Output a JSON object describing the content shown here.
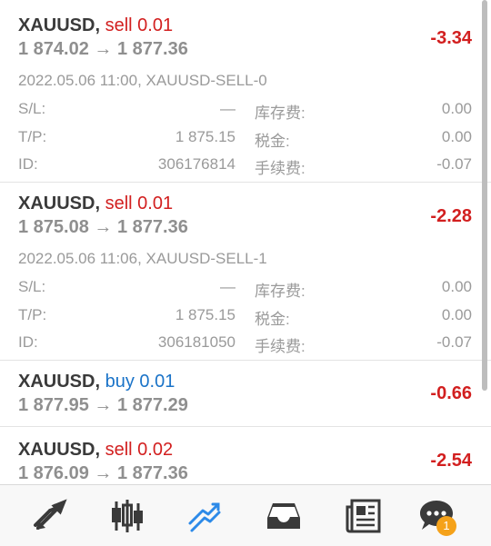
{
  "trades": [
    {
      "symbol": "XAUUSD,",
      "action": "sell",
      "volume": "0.01",
      "prices": "1 874.02 → 1 877.36",
      "profit": "-3.34",
      "meta": "2022.05.06 11:00, XAUUSD-SELL-0",
      "sl_label": "S/L:",
      "sl_value": "—",
      "tp_label": "T/P:",
      "tp_value": "1 875.15",
      "id_label": "ID:",
      "id_value": "306176814",
      "swap_label": "库存费:",
      "swap_value": "0.00",
      "tax_label": "税金:",
      "tax_value": "0.00",
      "fee_label": "手续费:",
      "fee_value": "-0.07"
    },
    {
      "symbol": "XAUUSD,",
      "action": "sell",
      "volume": "0.01",
      "prices": "1 875.08 → 1 877.36",
      "profit": "-2.28",
      "meta": "2022.05.06 11:06, XAUUSD-SELL-1",
      "sl_label": "S/L:",
      "sl_value": "—",
      "tp_label": "T/P:",
      "tp_value": "1 875.15",
      "id_label": "ID:",
      "id_value": "306181050",
      "swap_label": "库存费:",
      "swap_value": "0.00",
      "tax_label": "税金:",
      "tax_value": "0.00",
      "fee_label": "手续费:",
      "fee_value": "-0.07"
    },
    {
      "symbol": "XAUUSD,",
      "action": "buy",
      "volume": "0.01",
      "prices": "1 877.95 → 1 877.29",
      "profit": "-0.66"
    },
    {
      "symbol": "XAUUSD,",
      "action": "sell",
      "volume": "0.02",
      "prices": "1 876.09 → 1 877.36",
      "profit": "-2.54"
    }
  ],
  "tabbar": {
    "items": [
      "quotes-icon",
      "chart-candles-icon",
      "trade-icon",
      "history-inbox-icon",
      "news-icon",
      "chat-icon"
    ],
    "active": "trade-icon",
    "chat_badge": "1"
  },
  "colors": {
    "sell": "#d21f1f",
    "buy": "#1a73c8",
    "profit_negative": "#d21f1f",
    "active_tab": "#2d8ae8",
    "tab_icon": "#3a3a3a",
    "badge": "#f5a21a"
  }
}
